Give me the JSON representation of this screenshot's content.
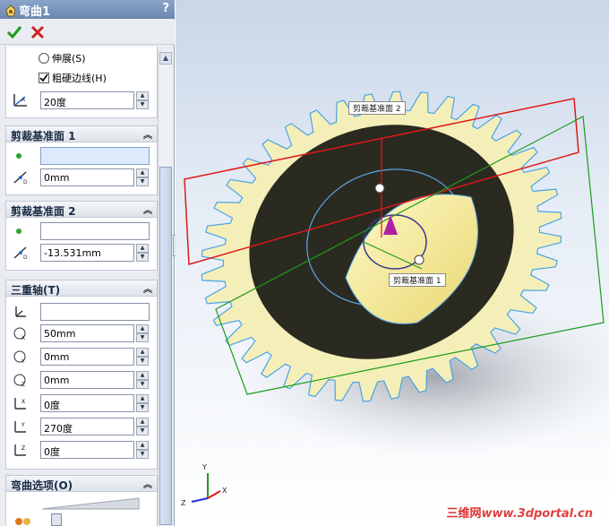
{
  "title": "弯曲1",
  "help": "?",
  "groups": {
    "options": {
      "stretch": "伸展(S)",
      "rough_edges": "粗硬边线(H)",
      "angle": "20度"
    },
    "trim1": {
      "title": "剪裁基准面 1",
      "ref": "",
      "distance": "0mm"
    },
    "trim2": {
      "title": "剪裁基准面 2",
      "ref": "",
      "distance": "-13.531mm"
    },
    "triad": {
      "title": "三重轴(T)",
      "ref": "",
      "x": "50mm",
      "y": "0mm",
      "z": "0mm",
      "rx": "0度",
      "ry": "270度",
      "rz": "0度"
    },
    "bend": {
      "title": "弯曲选项(O)"
    }
  },
  "viewport": {
    "plane1_label": "剪裁基准面 1",
    "plane2_label": "剪裁基准面 2",
    "axis_x": "X",
    "axis_y": "Y",
    "axis_z": "Z"
  },
  "watermark": {
    "cn": "三维网",
    "site": "www.3dportal.cn"
  },
  "colors": {
    "gear": "#f4efb8",
    "edge": "#4aa3e6",
    "plane2": "#e01818",
    "plane1": "#1c9c1c"
  }
}
